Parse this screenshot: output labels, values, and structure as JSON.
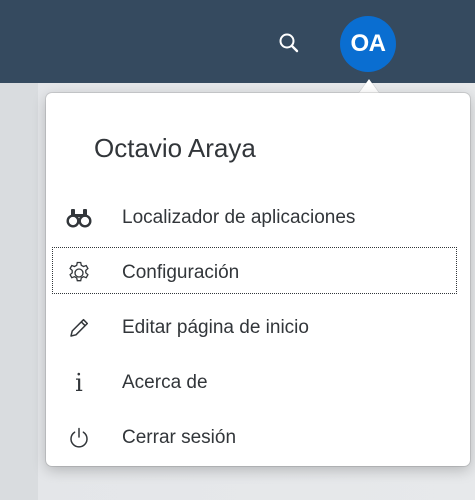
{
  "shellbar": {
    "search_icon": "search-icon",
    "avatar_initials": "OA",
    "background_color": "#354a5f",
    "avatar_color": "#0a6ed1"
  },
  "user_menu": {
    "user_name": "Octavio Araya",
    "items": [
      {
        "label": "Localizador de aplicaciones",
        "icon": "binoculars-icon"
      },
      {
        "label": "Configuración",
        "icon": "gear-icon",
        "focused": true
      },
      {
        "label": "Editar página de inicio",
        "icon": "pencil-icon"
      },
      {
        "label": "Acerca de",
        "icon": "info-icon"
      },
      {
        "label": "Cerrar sesión",
        "icon": "power-icon"
      }
    ]
  }
}
